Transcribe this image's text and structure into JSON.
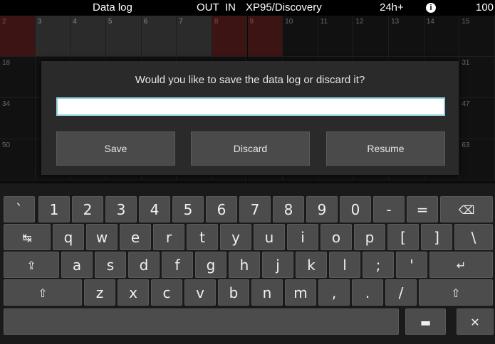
{
  "status_bar": {
    "title": "Data log",
    "out": "OUT",
    "in": "IN",
    "device": "XP95/Discovery",
    "timer": "24h+",
    "info_icon": "info-icon",
    "level": "100"
  },
  "grid": {
    "rows": [
      [
        "2",
        "3",
        "4",
        "5",
        "6",
        "7",
        "8",
        "9",
        "10",
        "11",
        "12",
        "13",
        "14",
        "15"
      ],
      [
        "18",
        "",
        "",
        "",
        "",
        "",
        "",
        "",
        "",
        "",
        "",
        "",
        "",
        "31"
      ],
      [
        "34",
        "",
        "",
        "",
        "",
        "",
        "",
        "",
        "",
        "",
        "",
        "",
        "",
        "47"
      ],
      [
        "50",
        "",
        "",
        "",
        "",
        "",
        "",
        "",
        "",
        "",
        "",
        "",
        "",
        "63"
      ]
    ]
  },
  "dialog": {
    "question": "Would you like to save the data log or discard it?",
    "input_value": "",
    "save_label": "Save",
    "discard_label": "Discard",
    "resume_label": "Resume"
  },
  "keyboard": {
    "row1": [
      "`",
      "1",
      "2",
      "3",
      "4",
      "5",
      "6",
      "7",
      "8",
      "9",
      "0",
      "-",
      "=",
      "⌫"
    ],
    "row2": [
      "↹",
      "q",
      "w",
      "e",
      "r",
      "t",
      "y",
      "u",
      "i",
      "o",
      "p",
      "[",
      "]",
      "\\"
    ],
    "row3": [
      "⇪",
      "a",
      "s",
      "d",
      "f",
      "g",
      "h",
      "j",
      "k",
      "l",
      ";",
      "'",
      "↵"
    ],
    "row4": [
      "⇧",
      "z",
      "x",
      "c",
      "v",
      "b",
      "n",
      "m",
      ",",
      ".",
      "/",
      "⇧"
    ],
    "row5": [
      "",
      "▬",
      "✕"
    ]
  }
}
